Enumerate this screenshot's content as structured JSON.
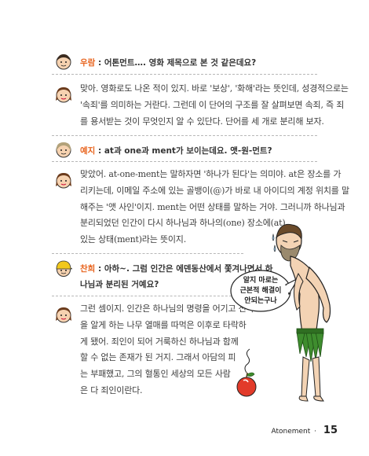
{
  "q1": {
    "name": "우람",
    "colon": " : ",
    "text": "어톤먼트…. 영화 제목으로 본 것 같은데요?"
  },
  "a1": {
    "lines": [
      "맞아. 영화로도 나온 적이 있지. 바로 '보상', '화해'라는 뜻인데, 성경적으로는",
      "'속죄'를 의미하는 거란다. 그런데 이 단어의 구조를 잘 살펴보면 속죄, 즉 죄",
      "를 용서받는 것이 무엇인지 알 수 있단다. 단어를 세 개로 분리해 보자."
    ]
  },
  "q2": {
    "name": "예지",
    "colon": " : ",
    "text": "at과 one과 ment가 보이는데요. 앳-원-먼트?"
  },
  "a2": {
    "lines": [
      "맞았어. at-one-ment는 말하자면 '하나가 된다'는 의미야. at은 장소를 가",
      "리키는데, 이메일 주소에 있는 골뱅이(@)가 바로 내 아이디의 계정 위치를 말",
      "해주는 '앳 사인'이지. ment는 어떤 상태를 말하는 거야. 그러니까 하나님과",
      "분리되었던 인간이 다시 하나님과 하나의(one) 장소에(at)",
      "있는 상태(ment)라는 뜻이지."
    ]
  },
  "q3": {
    "name": "찬희",
    "colon": " : ",
    "line1": "아하~. 그럼 인간은 에덴동산에서 쫓겨나면서 하",
    "line2": "나님과 분리된 거예요?"
  },
  "a3": {
    "lines": [
      "그런 셈이지. 인간은 하나님의 명령을 어기고 선악",
      "을 알게 하는 나무 열매를 따먹은 이후로 타락하",
      "게 됐어. 죄인이 되어 거룩하신 하나님과 함께",
      "할 수 없는 존재가 된 거지. 그래서 아담의 피",
      "는 부패했고, 그의 혈통인 세상의 모든 사람",
      "은 다 죄인이란다."
    ]
  },
  "bubble": {
    "lines": [
      "알지 마로는",
      "근본적 해결이",
      "안되는구나"
    ]
  },
  "footer": {
    "label": "Atonement",
    "dot": "·",
    "page": "15"
  },
  "colors": {
    "accent": "#e8641e",
    "text": "#3d3d3d",
    "leaf": "#3e8d2e"
  }
}
